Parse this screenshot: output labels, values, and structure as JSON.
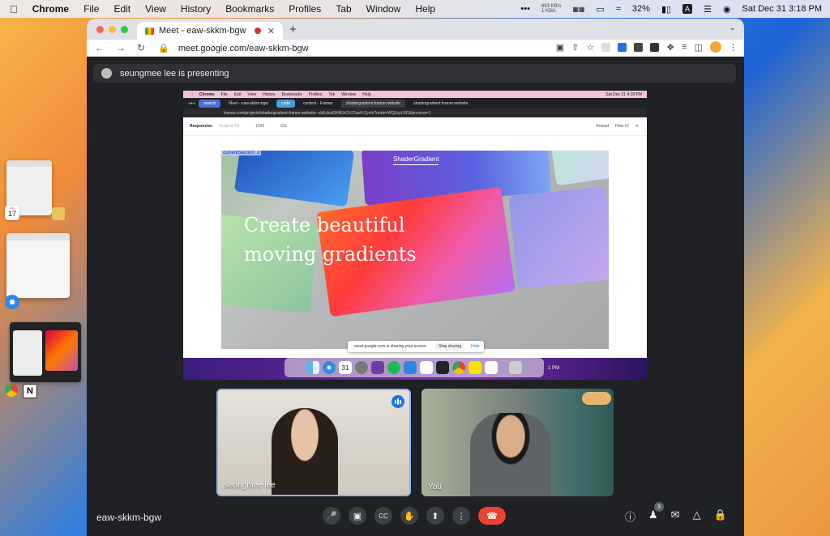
{
  "menubar": {
    "app": "Chrome",
    "items": [
      "File",
      "Edit",
      "View",
      "History",
      "Bookmarks",
      "Profiles",
      "Tab",
      "Window",
      "Help"
    ],
    "net_up": "893 KB/s",
    "net_down": "1 KB/s",
    "battery": "32%",
    "input": "A",
    "datetime": "Sat Dec 31  3:18 PM"
  },
  "stage_manager": {
    "calendar_month": "JUL",
    "calendar_day": "17"
  },
  "browser": {
    "tab_title": "Meet - eaw-skkm-bgw",
    "new_tab": "+",
    "url": "meet.google.com/eaw-skkm-bgw"
  },
  "presenting": {
    "text": "seungmee lee is presenting"
  },
  "shared_screen": {
    "menubar_items": [
      "Chrome",
      "File",
      "Edit",
      "View",
      "History",
      "Bookmarks",
      "Profiles",
      "Tab",
      "Window",
      "Help"
    ],
    "menubar_time": "Sat Dec 31  4:18 PM",
    "tabs": [
      "search",
      "Meet - eaw-skkm-bgw",
      "code",
      "content - Framer",
      "shadergradient.framer.website",
      "shadergradient.framer.website"
    ],
    "url": "framer.com/projects/shadergradient-framer-website--vIdLdesDHIKJrCh7ZaeH-2ynlo?node=WQLkyLRf1&preview=1",
    "toolbar": {
      "responsive": "Responsive",
      "scale": "Scale to Fit",
      "width": "1200",
      "height": "611",
      "reload": "Reload",
      "hide_ui": "Hide UI"
    },
    "cursor_label": "currentSection: 3",
    "brand": "ShaderGradient",
    "hero_line1": "Create beautiful",
    "hero_line2": "moving gradients",
    "sharing_text": "meet.google.com is sharing your screen.",
    "stop_sharing": "Stop sharing",
    "hide": "Hide",
    "dock_time": "1 PM",
    "dock_badge_calendar": "31"
  },
  "participants": [
    {
      "name": "seungmee lee",
      "speaking": true
    },
    {
      "name": "You",
      "speaking": false
    }
  ],
  "controls": {
    "meeting_code": "eaw-skkm-bgw",
    "people_count": "3"
  },
  "colors": {
    "end_call": "#ea4335",
    "accent": "#1a73e8",
    "meet_bg": "#202124"
  }
}
